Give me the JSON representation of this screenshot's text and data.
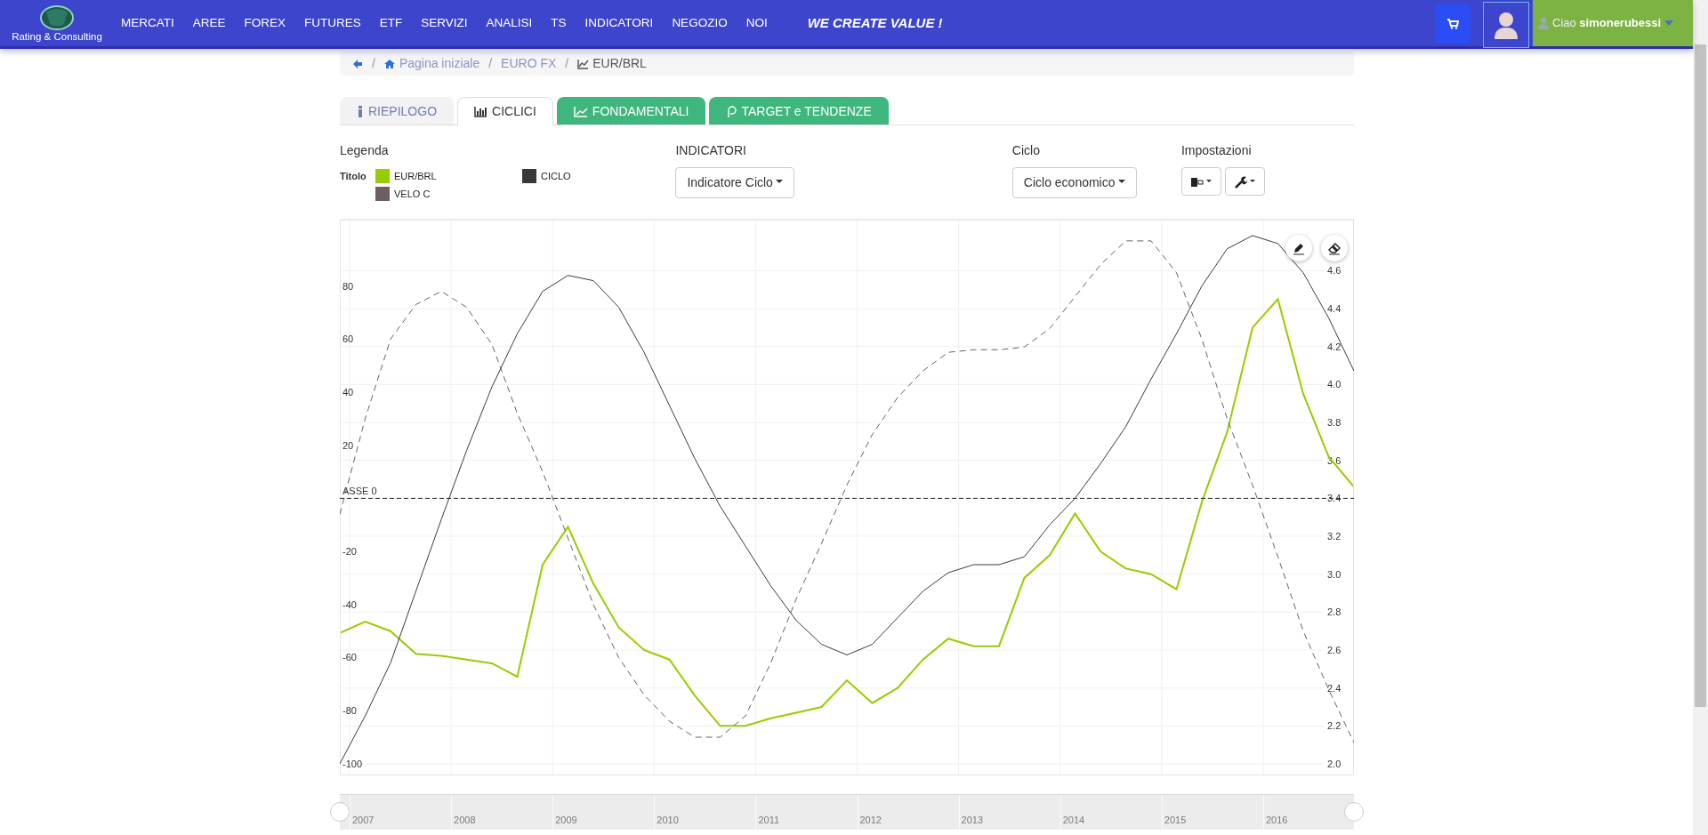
{
  "navbar": {
    "logo_text": "Rating & Consulting",
    "menu": [
      {
        "label": "MERCATI"
      },
      {
        "label": "AREE"
      },
      {
        "label": "FOREX"
      },
      {
        "label": "FUTURES"
      },
      {
        "label": "ETF"
      },
      {
        "label": "SERVIZI"
      },
      {
        "label": "ANALISI"
      },
      {
        "label": "TS"
      },
      {
        "label": "INDICATORI"
      },
      {
        "label": "NEGOZIO"
      },
      {
        "label": "NOI"
      }
    ],
    "slogan": "WE CREATE VALUE !",
    "user": {
      "greeting": "Ciao",
      "name": "simonerubessi"
    }
  },
  "breadcrumb": [
    {
      "separator": "/",
      "label": "Pagina iniziale"
    },
    {
      "separator": "/",
      "label": "EURO FX"
    },
    {
      "separator": "/",
      "label": "EUR/BRL"
    }
  ],
  "tabs": [
    {
      "label": "RIEPILOGO",
      "selected": false,
      "kind": "summary"
    },
    {
      "label": "CICLICI",
      "selected": true,
      "kind": "cycles"
    },
    {
      "label": "FONDAMENTALI",
      "selected": false,
      "kind": "fundamentals"
    },
    {
      "label": "TARGET e TENDENZE",
      "selected": false,
      "kind": "targets"
    }
  ],
  "legend": {
    "title": "Legenda",
    "label": "Titolo"
  },
  "controls": [
    {
      "label": "INDICATORI",
      "buttons": [
        {
          "kind": "text",
          "text": "Indicatore Ciclo"
        }
      ]
    },
    {
      "label": "Ciclo",
      "buttons": [
        {
          "kind": "text",
          "text": "Ciclo economico"
        }
      ]
    },
    {
      "label": "Impostazioni",
      "buttons": [
        {
          "kind": "display"
        },
        {
          "kind": "wrench"
        }
      ]
    }
  ],
  "chart": {
    "tools": [
      {
        "kind": "pencil"
      },
      {
        "kind": "eraser"
      }
    ],
    "price_chart": {
      "chart_data": {
        "type": "line",
        "ylim": [
          1.939,
          4.869
        ],
        "yticks": [
          {
            "value": 2.0,
            "label": "2.0"
          },
          {
            "value": 2.2,
            "label": "2.2"
          },
          {
            "value": 2.4,
            "label": "2.4"
          },
          {
            "value": 2.6,
            "label": "2.6"
          },
          {
            "value": 2.8,
            "label": "2.8"
          },
          {
            "value": 3.0,
            "label": "3.0"
          },
          {
            "value": 3.2,
            "label": "3.2"
          },
          {
            "value": 3.4,
            "label": "3.4"
          },
          {
            "value": 3.6,
            "label": "3.6"
          },
          {
            "value": 3.8,
            "label": "3.8"
          },
          {
            "value": 4.0,
            "label": "4.0"
          },
          {
            "value": 4.2,
            "label": "4.2"
          },
          {
            "value": 4.4,
            "label": "4.4"
          },
          {
            "value": 4.6,
            "label": "4.6"
          }
        ],
        "categories": [
          null,
          null,
          null,
          null,
          null,
          null,
          null,
          null,
          null,
          null,
          null,
          null,
          null,
          null,
          null,
          null,
          null,
          null,
          null,
          null,
          null,
          null,
          null,
          null,
          null,
          null,
          null,
          null,
          null,
          null,
          null,
          null,
          null,
          null,
          null,
          null,
          null,
          null,
          null,
          null,
          null
        ],
        "series": [
          {
            "name": "EUR/BRL",
            "color": "#99cc00",
            "line_style": "solid",
            "values": [
              2.69,
              2.75,
              2.7,
              2.58,
              2.57,
              2.55,
              2.53,
              2.46,
              3.05,
              3.25,
              2.95,
              2.72,
              2.6,
              2.55,
              2.36,
              2.2,
              2.2,
              2.24,
              2.27,
              2.3,
              2.44,
              2.32,
              2.4,
              2.55,
              2.66,
              2.62,
              2.62,
              2.98,
              3.1,
              3.32,
              3.12,
              3.03,
              3.0,
              2.92,
              3.38,
              3.75,
              4.3,
              4.45,
              3.95,
              3.62,
              3.46
            ]
          }
        ]
      }
    },
    "cycle_chart": {
      "chart_data": {
        "type": "line",
        "ylim": [
          -104.4,
          105
        ],
        "yticks": [
          {
            "value": -100,
            "label": "-100"
          },
          {
            "value": -80,
            "label": "-80"
          },
          {
            "value": -60,
            "label": "-60"
          },
          {
            "value": -40,
            "label": "-40"
          },
          {
            "value": -20,
            "label": "-20"
          },
          {
            "value": 20,
            "label": "20"
          },
          {
            "value": 40,
            "label": "40"
          },
          {
            "value": 60,
            "label": "60"
          },
          {
            "value": 80,
            "label": "80"
          }
        ],
        "ref_lines": [
          {
            "axis": "y",
            "value": 0,
            "label": "ASSE 0"
          }
        ],
        "categories": [
          null,
          null,
          null,
          null,
          null,
          null,
          null,
          null,
          null,
          null,
          null,
          null,
          null,
          null,
          null,
          null,
          null,
          null,
          null,
          null,
          null,
          null,
          null,
          null,
          null,
          null,
          null,
          null,
          null,
          null,
          null,
          null,
          null,
          null,
          null,
          null,
          null,
          null,
          null,
          null,
          null
        ],
        "series": [
          {
            "name": "VELO C",
            "color": "#6d5f5f",
            "line_style": "dashed",
            "values": [
              -6,
              30,
              60,
              73,
              78,
              72,
              58,
              32,
              10,
              -15,
              -40,
              -60,
              -74,
              -84,
              -90,
              -90,
              -82,
              -62,
              -38,
              -17,
              5,
              24,
              38,
              48,
              55,
              56,
              56,
              57,
              64,
              76,
              88,
              97,
              97,
              85,
              60,
              30,
              5,
              -22,
              -50,
              -72,
              -92
            ]
          },
          {
            "name": "CICLO",
            "color": "#3d3838",
            "line_style": "solid",
            "values": [
              -100,
              -82,
              -62,
              -35,
              -8,
              18,
              42,
              62,
              78,
              84,
              82,
              72,
              55,
              35,
              15,
              -3,
              -18,
              -33,
              -46,
              -55,
              -59,
              -55,
              -45,
              -35,
              -28,
              -25,
              -25,
              -22,
              -10,
              0,
              13,
              27,
              45,
              62,
              80,
              94,
              99,
              96,
              85,
              68,
              48
            ]
          }
        ]
      }
    }
  },
  "navigator": {
    "labels": [
      "2007",
      "2008",
      "2009",
      "2010",
      "2011",
      "2012",
      "2013",
      "2014",
      "2015",
      "2016"
    ]
  }
}
